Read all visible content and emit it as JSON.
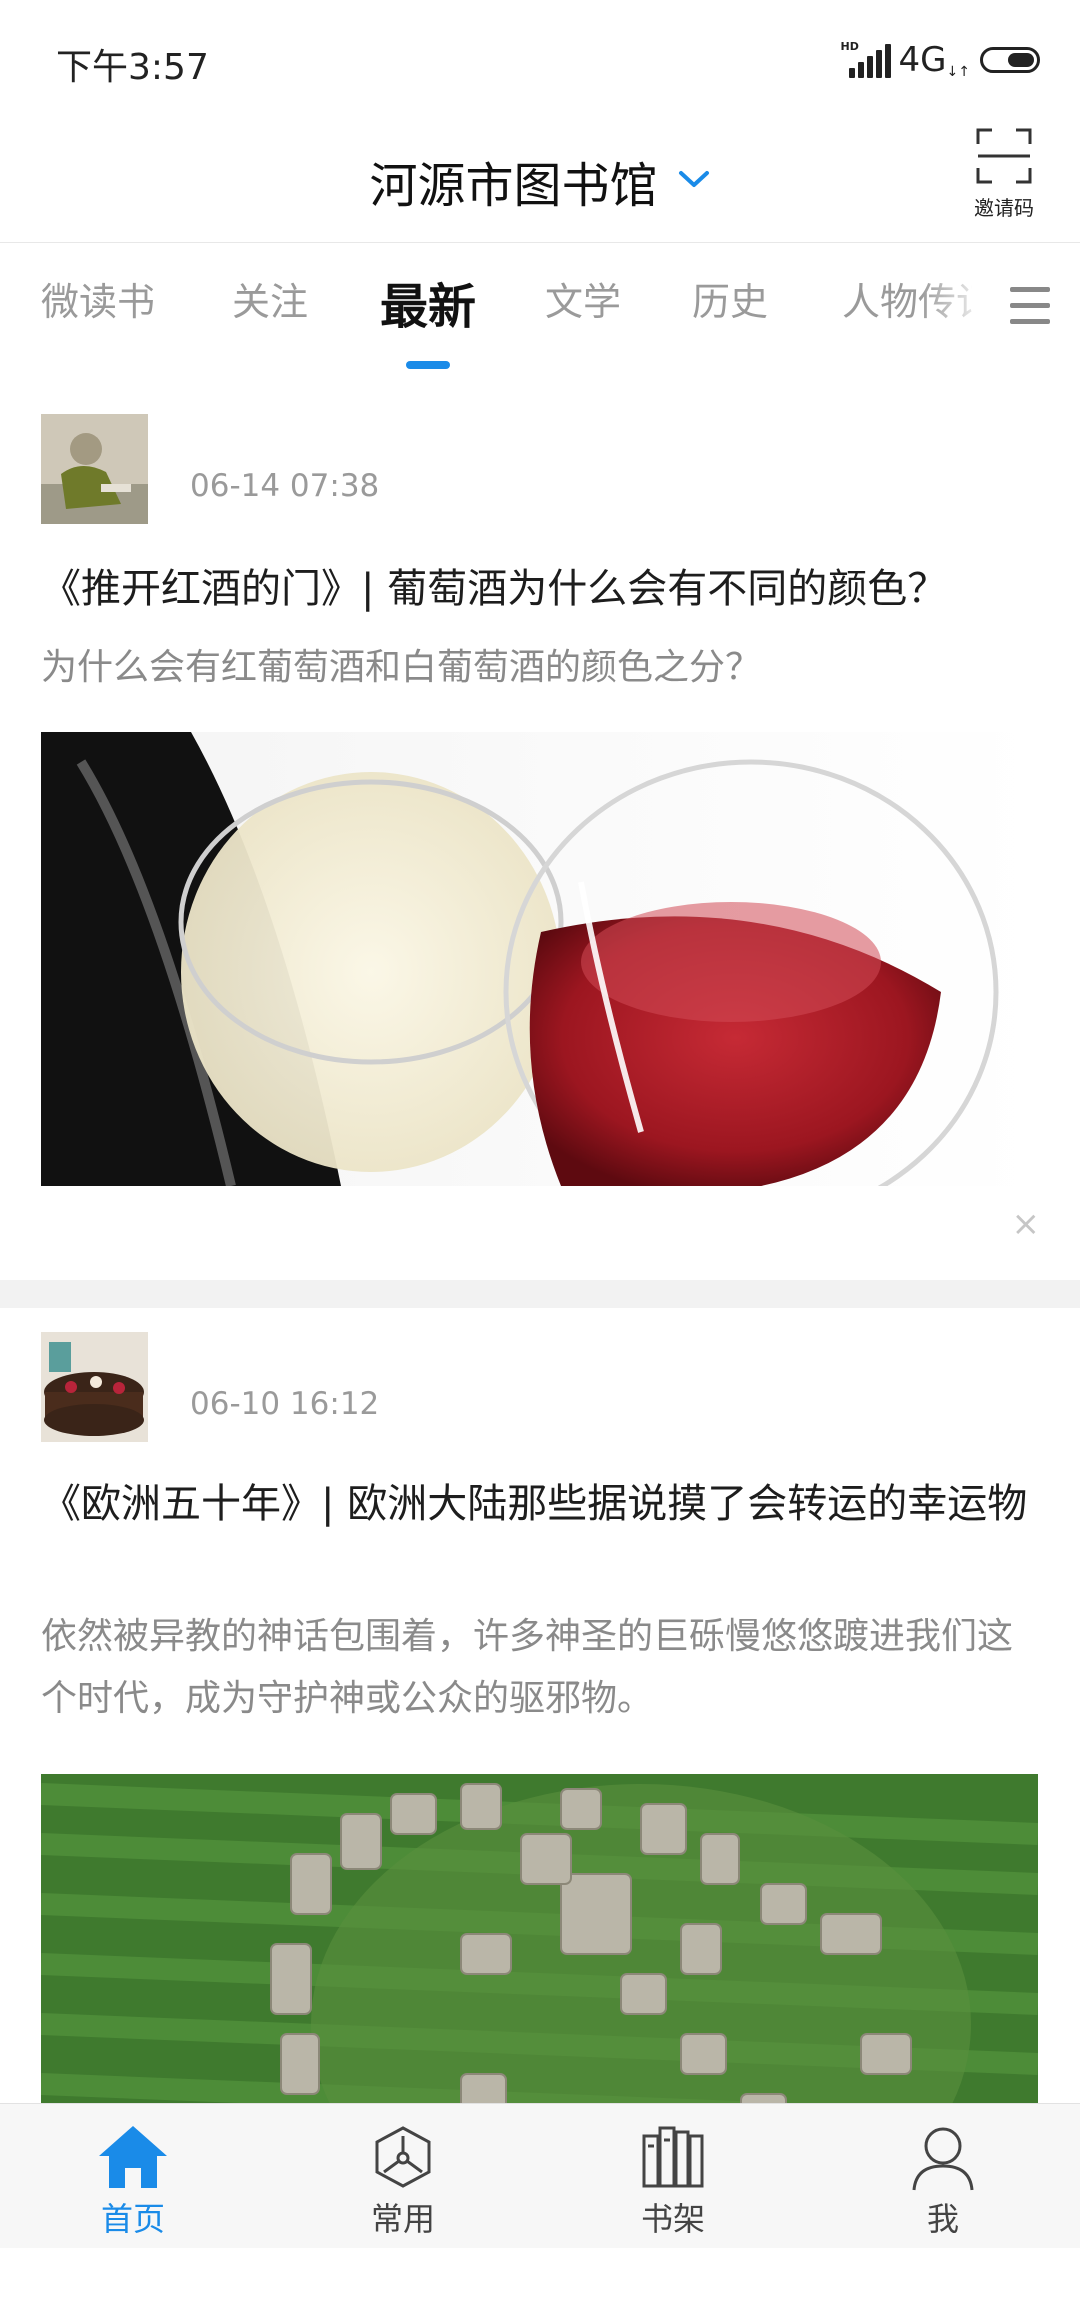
{
  "status": {
    "time": "下午3:57",
    "hd": "HD",
    "network": "4G"
  },
  "header": {
    "title": "河源市图书馆",
    "invite_label": "邀请码"
  },
  "tabs": [
    {
      "label": "微读书"
    },
    {
      "label": "关注"
    },
    {
      "label": "最新",
      "active": true
    },
    {
      "label": "文学"
    },
    {
      "label": "历史"
    },
    {
      "label": "人物传记"
    }
  ],
  "feed": [
    {
      "date": "06-14 07:38",
      "title": "《推开红酒的门》| 葡萄酒为什么会有不同的颜色？",
      "summary": "为什么会有红葡萄酒和白葡萄酒的颜色之分？",
      "close": "×"
    },
    {
      "date": "06-10 16:12",
      "title": "《欧洲五十年》| 欧洲大陆那些据说摸了会转运的幸运物",
      "summary": "依然被异教的神话包围着，许多神圣的巨砾慢悠悠踱进我们这个时代，成为守护神或公众的驱邪物。"
    }
  ],
  "bottom_nav": [
    {
      "label": "首页",
      "icon": "home-icon",
      "active": true
    },
    {
      "label": "常用",
      "icon": "compass-icon"
    },
    {
      "label": "书架",
      "icon": "bookshelf-icon"
    },
    {
      "label": "我",
      "icon": "user-icon"
    }
  ],
  "colors": {
    "accent": "#1a8be8",
    "muted": "#9a9a9a",
    "separator": "#f2f2f2"
  }
}
